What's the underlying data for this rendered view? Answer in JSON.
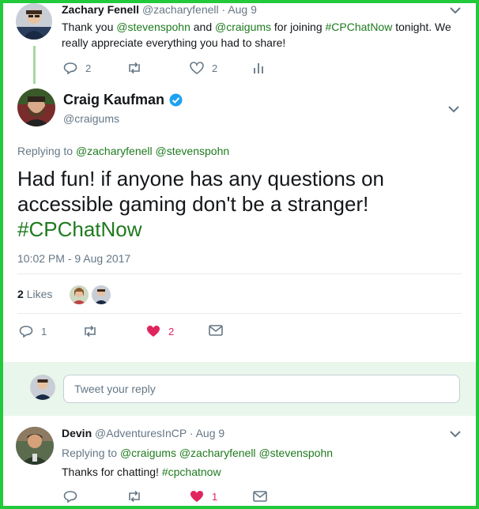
{
  "colors": {
    "frame": "#22c93a",
    "link": "#1e7a1e",
    "like": "#e0245e",
    "verified": "#1da1f2"
  },
  "parent_tweet": {
    "name": "Zachary Fenell",
    "handle": "@zacharyfenell",
    "date": "· Aug 9",
    "text_1": "Thank you ",
    "mention_1": "@stevenspohn",
    "text_2": " and ",
    "mention_2": "@craigums",
    "text_3": " for joining ",
    "hashtag": "#CPChatNow",
    "text_4": " tonight. We",
    "line2": "really appreciate everything you had to share!",
    "reply_count": "2",
    "like_count": "2"
  },
  "main_tweet": {
    "name": "Craig Kaufman",
    "handle": "@craigums",
    "replying_label": "Replying to ",
    "replying_1": "@zacharyfenell",
    "replying_2": "@stevenspohn",
    "text_line1": "Had fun! if anyone has any questions on",
    "text_line2": "accessible gaming don't be a stranger!",
    "hashtag": "#CPChatNow",
    "timestamp": "10:02 PM - 9 Aug 2017",
    "likes_count": "2",
    "likes_label": "Likes",
    "reply_count": "1",
    "like_count": "2"
  },
  "reply_box": {
    "placeholder": "Tweet your reply"
  },
  "reply_tweet": {
    "name": "Devin",
    "handle": "@AdventuresInCP",
    "date": "· Aug 9",
    "replying_label": "Replying to ",
    "replying_1": "@craigums",
    "replying_2": "@zacharyfenell",
    "replying_3": "@stevenspohn",
    "text": "Thanks for chatting! ",
    "hashtag": "#cpchatnow",
    "like_count": "1"
  }
}
